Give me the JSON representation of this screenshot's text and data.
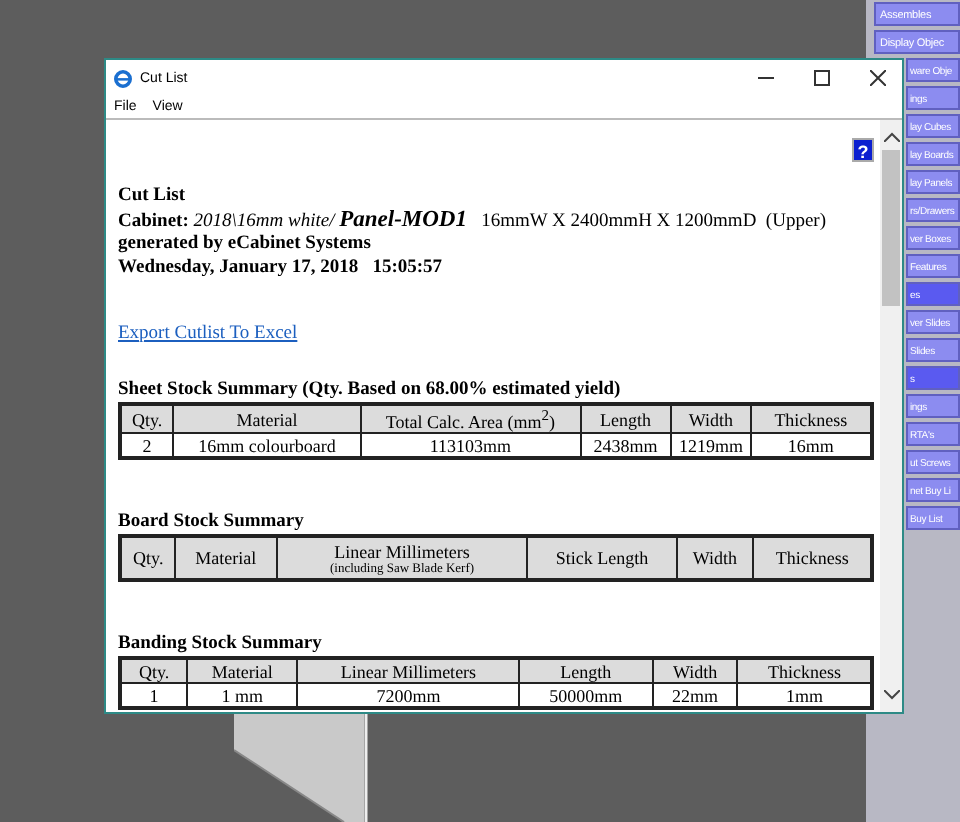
{
  "side_panel": {
    "items": [
      {
        "label": "Assembles",
        "color": "#8c8cf0"
      },
      {
        "label": "Display Objec",
        "color": "#8c8cf0"
      }
    ]
  },
  "side_panel_behind_window": {
    "items": [
      {
        "label": "ware Obje",
        "color": "#8c8cf0"
      },
      {
        "label": "ings",
        "color": "#8c8cf0"
      },
      {
        "label": "lay Cubes",
        "color": "#8c8cf0"
      },
      {
        "label": "lay Boards",
        "color": "#8c8cf0"
      },
      {
        "label": "lay Panels",
        "color": "#8c8cf0"
      },
      {
        "label": "rs/Drawers",
        "color": "#8c8cf0"
      },
      {
        "label": "ver Boxes",
        "color": "#8c8cf0"
      },
      {
        "label": "Features",
        "color": "#8c8cf0"
      },
      {
        "label": "es",
        "color": "#5a5af0"
      },
      {
        "label": "ver Slides",
        "color": "#8c8cf0"
      },
      {
        "label": "Slides",
        "color": "#8c8cf0"
      },
      {
        "label": "s",
        "color": "#5a5af0"
      },
      {
        "label": "ings",
        "color": "#8c8cf0"
      },
      {
        "label": "RTA's",
        "color": "#8c8cf0"
      },
      {
        "label": "ut Screws",
        "color": "#8c8cf0"
      },
      {
        "label": "net Buy Li",
        "color": "#8c8cf0"
      },
      {
        "label": "Buy List",
        "color": "#8c8cf0"
      }
    ]
  },
  "window": {
    "title": "Cut List",
    "menu": [
      "File",
      "View"
    ],
    "help": "?",
    "report": {
      "title": "Cut List",
      "cabinet": {
        "label": "Cabinet:",
        "path": "2018\\16mm white/",
        "part": "Panel-MOD1",
        "dims": "16mmW X 2400mmH X 1200mmD  (Upper)"
      },
      "generator": "generated by eCabinet Systems",
      "date": "Wednesday, January 17, 2018   15:05:57",
      "export_link": "Export Cutlist To Excel",
      "tables": [
        {
          "heading": "Sheet Stock Summary (Qty. Based on 68.00% estimated yield)",
          "columns": [
            {
              "label": "Qty."
            },
            {
              "label": "Material"
            },
            {
              "label": "Total Calc. Area (mm$^{2}$)"
            },
            {
              "label": "Length"
            },
            {
              "label": "Width"
            },
            {
              "label": "Thickness"
            }
          ],
          "rows": [
            [
              "2",
              "16mm colourboard",
              "113103mm",
              "2438mm",
              "1219mm",
              "16mm"
            ]
          ]
        },
        {
          "heading": "Board Stock Summary",
          "columns": [
            {
              "label": "Qty."
            },
            {
              "label": "Material"
            },
            {
              "label": "Linear Millimeters",
              "note": "(including Saw Blade Kerf)"
            },
            {
              "label": "Stick Length"
            },
            {
              "label": "Width"
            },
            {
              "label": "Thickness"
            }
          ]
        },
        {
          "heading": "Banding Stock Summary",
          "columns": [
            {
              "label": "Qty."
            },
            {
              "label": "Material"
            },
            {
              "label": "Linear Millimeters"
            },
            {
              "label": "Length"
            },
            {
              "label": "Width"
            },
            {
              "label": "Thickness"
            }
          ],
          "rows": [
            [
              "1",
              "1 mm",
              "7200mm",
              "50000mm",
              "22mm",
              "1mm"
            ]
          ]
        }
      ]
    }
  }
}
